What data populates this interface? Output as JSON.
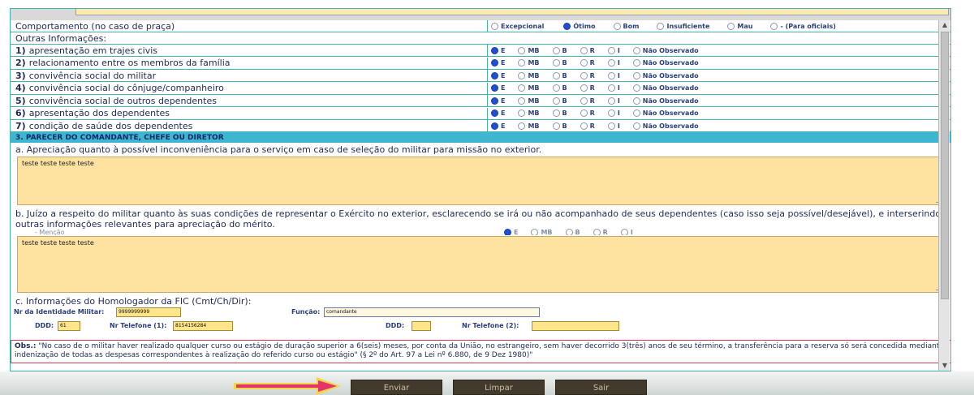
{
  "behavior": {
    "label": "Comportamento (no caso de praça)",
    "options": [
      "Excepcional",
      "Ótimo",
      "Bom",
      "Insuficiente",
      "Mau",
      "- (Para oficiais)"
    ],
    "selected": "Ótimo"
  },
  "outras_label": "Outras Informações:",
  "grade_options": [
    "E",
    "MB",
    "B",
    "R",
    "I",
    "Não Observado"
  ],
  "info_rows": [
    {
      "num": "1)",
      "text": "apresentação em trajes civis",
      "selected": "E"
    },
    {
      "num": "2)",
      "text": "relacionamento entre os membros da família",
      "selected": "E"
    },
    {
      "num": "3)",
      "text": "convivência social do militar",
      "selected": "E"
    },
    {
      "num": "4)",
      "text": "convivência social do cônjuge/companheiro",
      "selected": "E"
    },
    {
      "num": "5)",
      "text": "convivência social de outros dependentes",
      "selected": "E"
    },
    {
      "num": "6)",
      "text": "apresentação dos dependentes",
      "selected": "E"
    },
    {
      "num": "7)",
      "text": "condição de saúde dos dependentes",
      "selected": "E"
    }
  ],
  "section3_title": "3. PARECER DO COMANDANTE, CHEFE OU DIRETOR",
  "question_a": "a. Apreciação quanto à possível inconveniência para o serviço em caso de seleção do militar para missão no exterior.",
  "answer_a": "teste teste teste teste",
  "question_b": "b. Juízo a respeito do militar quanto às suas condições de representar o Exército no exterior, esclarecendo se irá ou não acompanhado de seus dependentes (caso isso seja possível/desejável), e interserindo outras informações relevantes para apreciação do mérito.",
  "mencao_label": "- Menção",
  "mencao_options": [
    "E",
    "MB",
    "B",
    "R",
    "I"
  ],
  "answer_b": "teste teste teste teste",
  "section_c_title": "c. Informações do Homologador da FIC (Cmt/Ch/Dir):",
  "identidade_label": "Nr da Identidade Militar:",
  "identidade_value": "9999999999",
  "funcao_label": "Função:",
  "funcao_value": "comandante",
  "ddd1_label": "DDD:",
  "ddd1_value": "61",
  "tel1_label": "Nr Telefone (1):",
  "tel1_value": "8154156284",
  "ddd2_label": "DDD:",
  "ddd2_value": "",
  "tel2_label": "Nr Telefone (2):",
  "tel2_value": "",
  "obs_label": "Obs.:",
  "obs_text": "\"No caso de o militar haver realizado qualquer curso ou estágio de duração superior a 6(seis) meses, por conta da União, no estrangeiro, sem haver decorrido 3(três) anos de seu término, a transferência para a reserva só será concedida mediante indenização de todas as despesas correspondentes à realização do referido curso ou estágio\" (§ 2º do Art. 97 a Lei nº 6.880, de 9 Dez 1980)\"",
  "buttons": {
    "enviar": "Enviar",
    "limpar": "Limpar",
    "sair": "Sair"
  },
  "colors": {
    "accent_arrow": "#e4356b",
    "arrow_outline": "#f2d64b",
    "section_header": "#3fb6d1",
    "field_bg": "#fde2a0"
  },
  "icons": {
    "radio_selected": "radio-selected-icon",
    "radio_empty": "radio-empty-icon",
    "arrow": "right-arrow-icon"
  }
}
